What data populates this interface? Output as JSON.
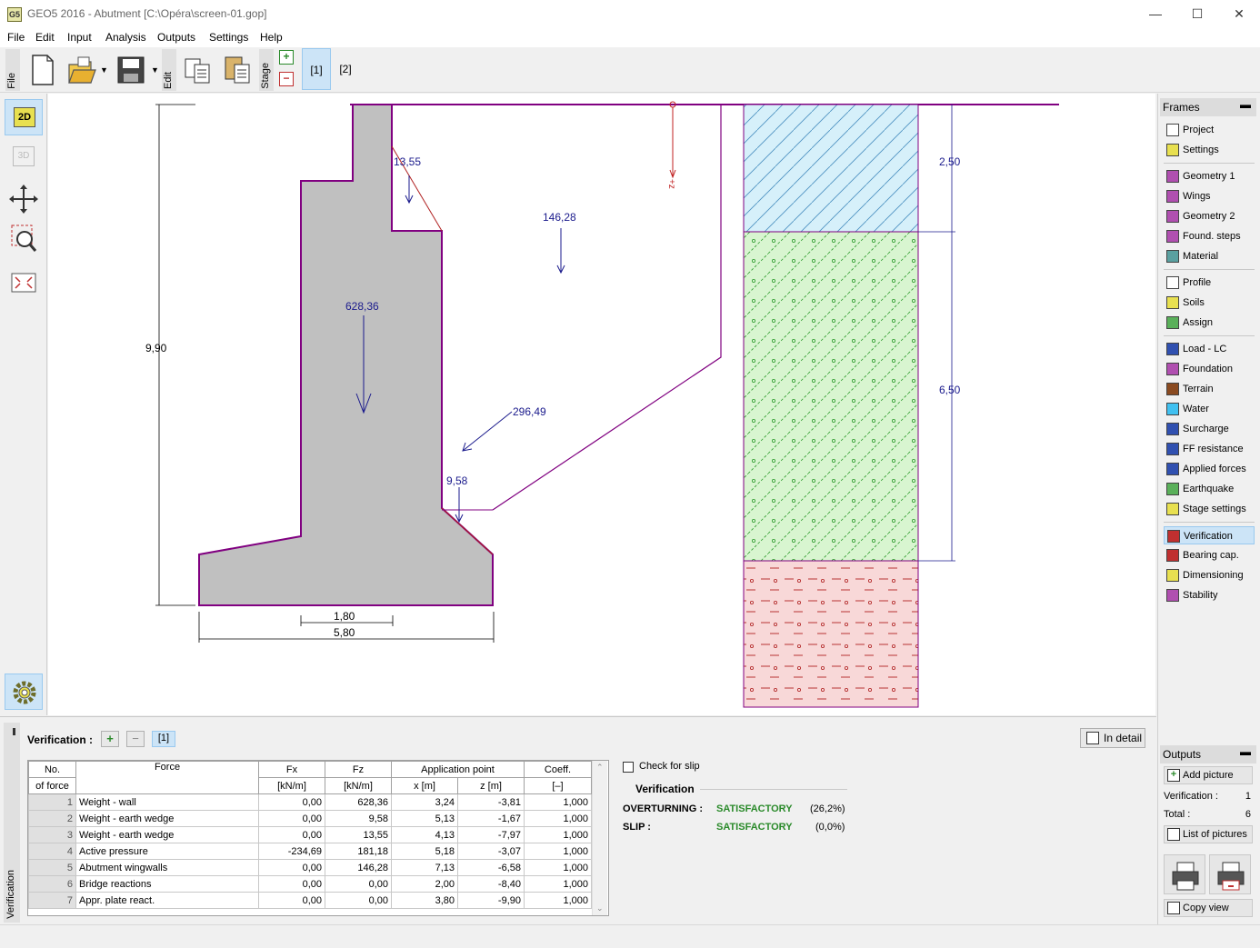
{
  "window": {
    "title": "GEO5 2016 - Abutment [C:\\Opéra\\screen-01.gop]",
    "app_icon": "G5",
    "minimize": "—",
    "maximize": "☐",
    "close": "✕"
  },
  "menu": [
    "File",
    "Edit",
    "Input",
    "Analysis",
    "Outputs",
    "Settings",
    "Help"
  ],
  "toolbar": {
    "file_label": "File",
    "edit_label": "Edit",
    "stage_label": "Stage",
    "stages": [
      "[1]",
      "[2]"
    ]
  },
  "left_tools": {
    "view_2d": "2D",
    "view_3d": "3D"
  },
  "drawing": {
    "wall_height": "9,90",
    "stem_width": "1,80",
    "base_width": "5,80",
    "layer1_thickness": "2,50",
    "layer2_thickness": "6,50",
    "force_labels": [
      "13,55",
      "146,28",
      "628,36",
      "296,49",
      "9,58"
    ],
    "z_marker": "+z"
  },
  "frames": {
    "header": "Frames",
    "minimize": "▬",
    "items": [
      {
        "label": "Project",
        "icon": "project-icon"
      },
      {
        "label": "Settings",
        "icon": "settings-icon"
      },
      {
        "label": "Geometry 1",
        "icon": "geometry-icon"
      },
      {
        "label": "Wings",
        "icon": "wings-icon"
      },
      {
        "label": "Geometry 2",
        "icon": "geometry2-icon"
      },
      {
        "label": "Found. steps",
        "icon": "foundation-steps-icon"
      },
      {
        "label": "Material",
        "icon": "material-icon"
      },
      {
        "label": "Profile",
        "icon": "profile-icon"
      },
      {
        "label": "Soils",
        "icon": "soils-icon"
      },
      {
        "label": "Assign",
        "icon": "assign-icon"
      },
      {
        "label": "Load - LC",
        "icon": "load-icon"
      },
      {
        "label": "Foundation",
        "icon": "foundation-icon"
      },
      {
        "label": "Terrain",
        "icon": "terrain-icon"
      },
      {
        "label": "Water",
        "icon": "water-icon"
      },
      {
        "label": "Surcharge",
        "icon": "surcharge-icon"
      },
      {
        "label": "FF resistance",
        "icon": "ff-resistance-icon"
      },
      {
        "label": "Applied forces",
        "icon": "applied-forces-icon"
      },
      {
        "label": "Earthquake",
        "icon": "earthquake-icon"
      },
      {
        "label": "Stage settings",
        "icon": "stage-settings-icon"
      },
      {
        "label": "Verification",
        "icon": "verification-icon"
      },
      {
        "label": "Bearing cap.",
        "icon": "bearing-capacity-icon"
      },
      {
        "label": "Dimensioning",
        "icon": "dimensioning-icon"
      },
      {
        "label": "Stability",
        "icon": "stability-icon"
      }
    ],
    "active": "Verification"
  },
  "outputs": {
    "header": "Outputs",
    "minimize": "▬",
    "add_picture": "Add picture",
    "verification_label": "Verification :",
    "verification_count": "1",
    "total_label": "Total :",
    "total_count": "6",
    "list_of_pictures": "List of pictures",
    "copy_view": "Copy view"
  },
  "verification_panel": {
    "side_label": "Verification",
    "title": "Verification :",
    "add": "+",
    "remove": "−",
    "stage": "[1]",
    "in_detail": "In detail",
    "table": {
      "headers": {
        "no_1": "No.",
        "no_2": "of force",
        "force": "Force",
        "fx": "Fx",
        "fx_unit": "[kN/m]",
        "fz": "Fz",
        "fz_unit": "[kN/m]",
        "app_point": "Application point",
        "x": "x [m]",
        "z": "z [m]",
        "coeff": "Coeff.",
        "coeff_unit": "[–]"
      },
      "rows": [
        {
          "no": "1",
          "force": "Weight - wall",
          "fx": "0,00",
          "fz": "628,36",
          "x": "3,24",
          "z": "-3,81",
          "coeff": "1,000"
        },
        {
          "no": "2",
          "force": "Weight - earth wedge",
          "fx": "0,00",
          "fz": "9,58",
          "x": "5,13",
          "z": "-1,67",
          "coeff": "1,000"
        },
        {
          "no": "3",
          "force": "Weight - earth wedge",
          "fx": "0,00",
          "fz": "13,55",
          "x": "4,13",
          "z": "-7,97",
          "coeff": "1,000"
        },
        {
          "no": "4",
          "force": "Active pressure",
          "fx": "-234,69",
          "fz": "181,18",
          "x": "5,18",
          "z": "-3,07",
          "coeff": "1,000"
        },
        {
          "no": "5",
          "force": "Abutment wingwalls",
          "fx": "0,00",
          "fz": "146,28",
          "x": "7,13",
          "z": "-6,58",
          "coeff": "1,000"
        },
        {
          "no": "6",
          "force": "Bridge reactions",
          "fx": "0,00",
          "fz": "0,00",
          "x": "2,00",
          "z": "-8,40",
          "coeff": "1,000"
        },
        {
          "no": "7",
          "force": "Appr. plate react.",
          "fx": "0,00",
          "fz": "0,00",
          "x": "3,80",
          "z": "-9,90",
          "coeff": "1,000"
        }
      ]
    },
    "check_for_slip": "Check for slip",
    "results_title": "Verification",
    "overturning_label": "OVERTURNING :",
    "overturning_status": "SATISFACTORY",
    "overturning_pct": "(26,2%)",
    "slip_label": "SLIP :",
    "slip_status": "SATISFACTORY",
    "slip_pct": "(0,0%)"
  },
  "colors": {
    "accent": "#cce4f7",
    "wall_fill": "#c0c0c0",
    "wall_outline": "#800080",
    "force_arrow": "#1a1a8c",
    "satisfactory": "#2a8a2a",
    "soil_top": "#d6f0fa",
    "soil_mid": "#d8f5d0",
    "soil_bottom": "#f8d8d8"
  }
}
